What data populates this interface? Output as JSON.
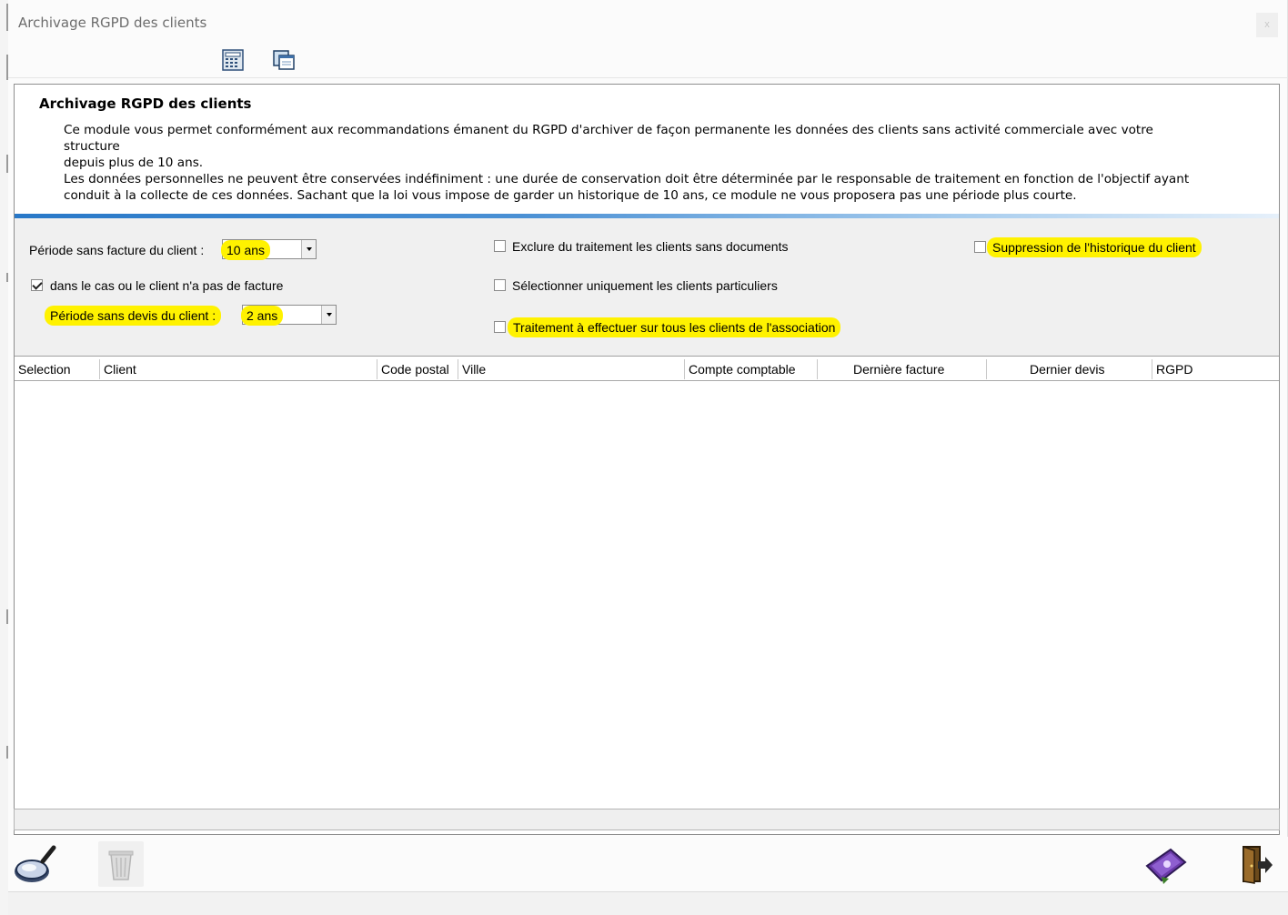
{
  "window": {
    "title": "Archivage RGPD des clients",
    "close_label": "x"
  },
  "toolbar": {
    "icons": [
      "calculator-icon",
      "preview-window-icon"
    ]
  },
  "description": {
    "title": "Archivage RGPD des clients",
    "text": "Ce module vous permet conformément aux recommandations émanent du RGPD d'archiver de façon permanente les données des clients sans activité commerciale avec votre structure\ndepuis plus de 10 ans.\nLes données personnelles ne peuvent être conservées indéfiniment : une durée de conservation doit être déterminée par le responsable de traitement en fonction de l'objectif ayant\nconduit à la collecte de ces données. Sachant que la loi vous impose de garder un historique de 10 ans, ce module ne vous proposera pas une période plus courte."
  },
  "options": {
    "periode_facture_label": "Période sans facture du client :",
    "periode_facture_value": "10 ans",
    "no_invoice_label": "dans le cas ou le client n'a pas de facture",
    "no_invoice_checked": true,
    "periode_devis_label": "Période sans devis du client :",
    "periode_devis_value": "2 ans",
    "exclude_label": "Exclure du traitement les clients sans documents",
    "exclude_checked": false,
    "particuliers_label": "Sélectionner uniquement les clients particuliers",
    "particuliers_checked": false,
    "association_label": "Traitement à effectuer sur tous les clients de l'association",
    "association_checked": false,
    "suppression_label": "Suppression de l'historique du client",
    "suppression_checked": false,
    "highlight_color": "#fff200"
  },
  "table": {
    "columns": [
      "Selection",
      "Client",
      "Code postal",
      "Ville",
      "Compte comptable",
      "Dernière facture",
      "Dernier devis",
      "RGPD"
    ],
    "rows": []
  },
  "bottom_toolbar": {
    "icons": [
      "search-magnifier-icon",
      "trash-bin-icon",
      "archive-ticket-icon",
      "exit-door-icon"
    ]
  },
  "colors": {
    "accent_bar": "#2878c8",
    "options_background": "#f0f0f0"
  }
}
